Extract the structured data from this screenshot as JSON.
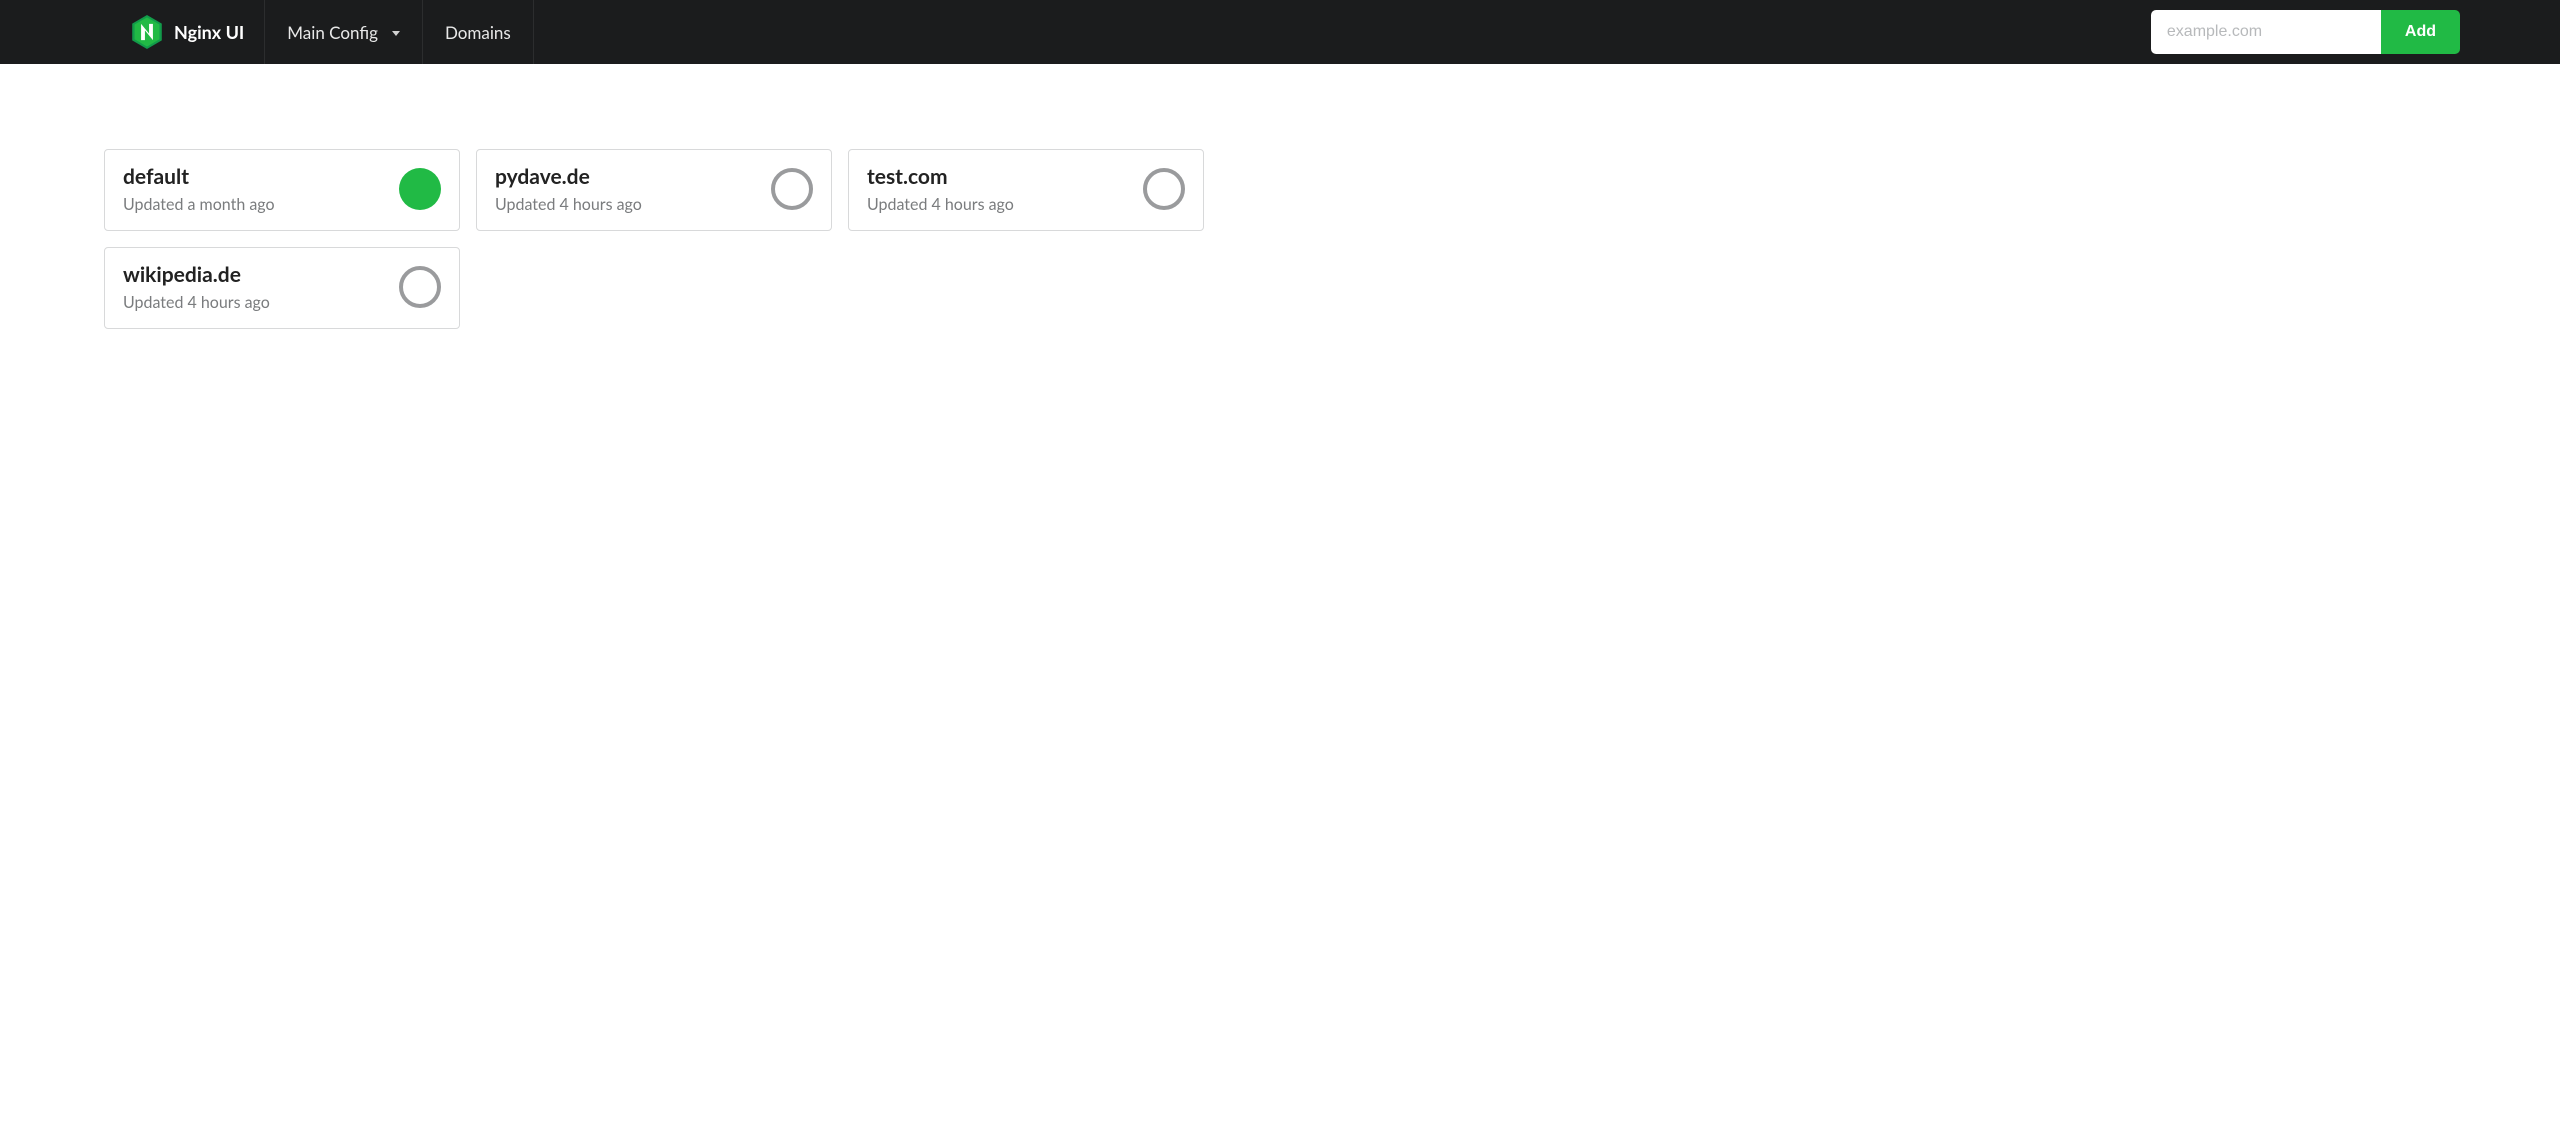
{
  "brand": {
    "name": "Nginx UI"
  },
  "nav": {
    "main_config": "Main Config",
    "domains": "Domains"
  },
  "add_form": {
    "placeholder": "example.com",
    "button": "Add"
  },
  "domains": [
    {
      "name": "default",
      "updated": "Updated a month ago",
      "enabled": true
    },
    {
      "name": "pydave.de",
      "updated": "Updated 4 hours ago",
      "enabled": false
    },
    {
      "name": "test.com",
      "updated": "Updated 4 hours ago",
      "enabled": false
    },
    {
      "name": "wikipedia.de",
      "updated": "Updated 4 hours ago",
      "enabled": false
    }
  ],
  "colors": {
    "accent": "#21ba45",
    "navbar": "#1b1c1d",
    "muted": "#7a7c7e",
    "border": "#d8d9da"
  }
}
